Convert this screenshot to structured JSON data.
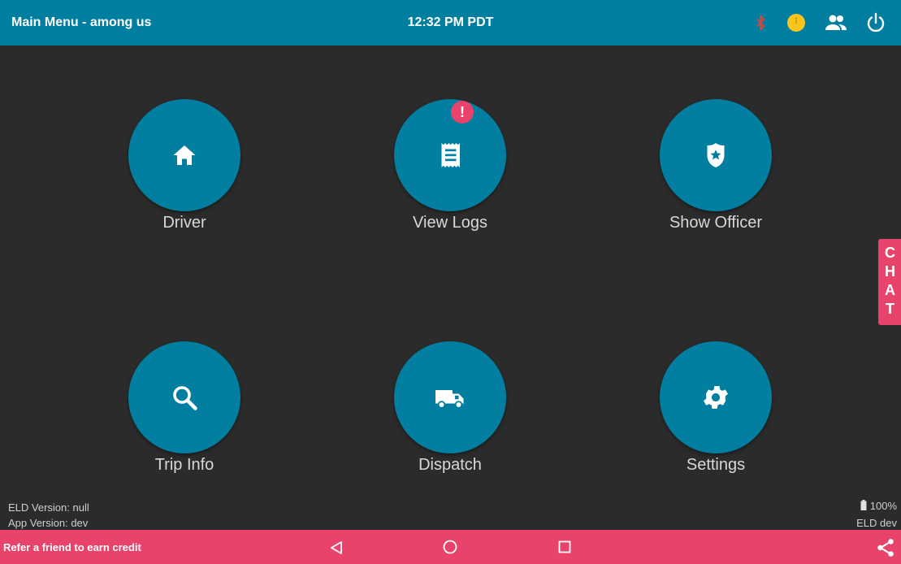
{
  "header": {
    "title": "Main Menu - among us",
    "clock": "12:32 PM PDT",
    "icons": [
      "bluetooth-icon",
      "status-dot-icon",
      "people-icon",
      "power-icon"
    ]
  },
  "tiles": [
    {
      "label": "Driver",
      "icon": "home-icon"
    },
    {
      "label": "View Logs",
      "icon": "logs-icon",
      "badge": "!"
    },
    {
      "label": "Show Officer",
      "icon": "officer-badge-icon"
    },
    {
      "label": "Trip Info",
      "icon": "search-icon"
    },
    {
      "label": "Dispatch",
      "icon": "truck-icon"
    },
    {
      "label": "Settings",
      "icon": "gear-icon"
    }
  ],
  "chat": {
    "label": "CHAT"
  },
  "footer": {
    "eld_version": "ELD Version: null",
    "app_version": "App Version: dev",
    "battery": "100%",
    "eld_mode": "ELD dev"
  },
  "bottom_bar": {
    "refer_text": "Refer a friend to earn credit",
    "nav": [
      "back-icon",
      "home-nav-icon",
      "recents-icon"
    ],
    "share_icon": "share-icon"
  },
  "colors": {
    "primary": "#027fa0",
    "accent": "#e8436b",
    "background": "#2b2b2b",
    "status_dot": "#f8c51c",
    "bluetooth": "#d9443f"
  }
}
